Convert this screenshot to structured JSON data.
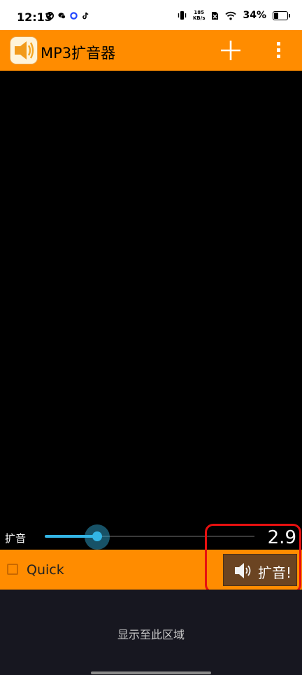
{
  "status_bar": {
    "time": "12:13",
    "net_speed_value": "185",
    "net_speed_unit": "KB/s",
    "battery_percent": "34%"
  },
  "app_bar": {
    "title": "MP3扩音器"
  },
  "controls": {
    "boost_label": "扩音",
    "boost_value": "2.9",
    "boost_fill_fraction": 0.25,
    "quick_label": "Quick",
    "quick_checked": false,
    "boost_button_label": "扩音!"
  },
  "ad_area": {
    "text": "显示至此区域"
  },
  "colors": {
    "accent_orange": "#ff8c00",
    "slider_blue": "#33b5e5",
    "highlight_red": "#e81010",
    "boost_button_brown": "#6b4422"
  }
}
